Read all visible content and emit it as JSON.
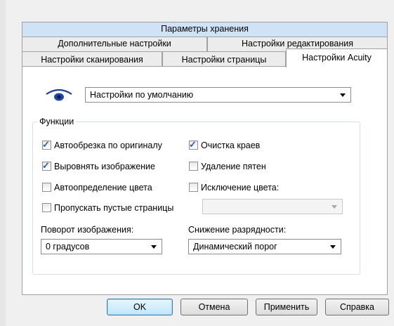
{
  "tabs_row1": [
    "Параметры хранения"
  ],
  "tabs_row2": [
    "Дополнительные настройки",
    "Настройки редактирования"
  ],
  "tabs_row3": [
    "Настройки сканирования",
    "Настройки страницы",
    "Настройки Acuity"
  ],
  "profile_select": {
    "value": "Настройки по умолчанию",
    "icon": "eye-icon"
  },
  "functions": {
    "legend": "Функции",
    "checkboxes": [
      {
        "label": "Автообрезка по оригиналу",
        "checked": true
      },
      {
        "label": "Очистка краев",
        "checked": true
      },
      {
        "label": "Выровнять изображение",
        "checked": true
      },
      {
        "label": "Удаление пятен",
        "checked": false
      },
      {
        "label": "Автоопределение цвета",
        "checked": false
      },
      {
        "label": "Исключение цвета:",
        "checked": false
      },
      {
        "label": "Пропускать пустые страницы",
        "checked": false
      }
    ],
    "color_drop_select": {
      "value": ""
    },
    "rotation": {
      "label": "Поворот изображения:",
      "value": "0 градусов"
    },
    "bit_depth": {
      "label": "Снижение разрядности:",
      "value": "Динамический порог"
    }
  },
  "buttons": {
    "ok": "OK",
    "cancel": "Отмена",
    "apply": "Применить",
    "help": "Справка"
  },
  "colors": {
    "back_tab_blue": "#cfe2f6",
    "check_mark": "#2a5fb0",
    "default_button_border": "#3c7fb1"
  }
}
